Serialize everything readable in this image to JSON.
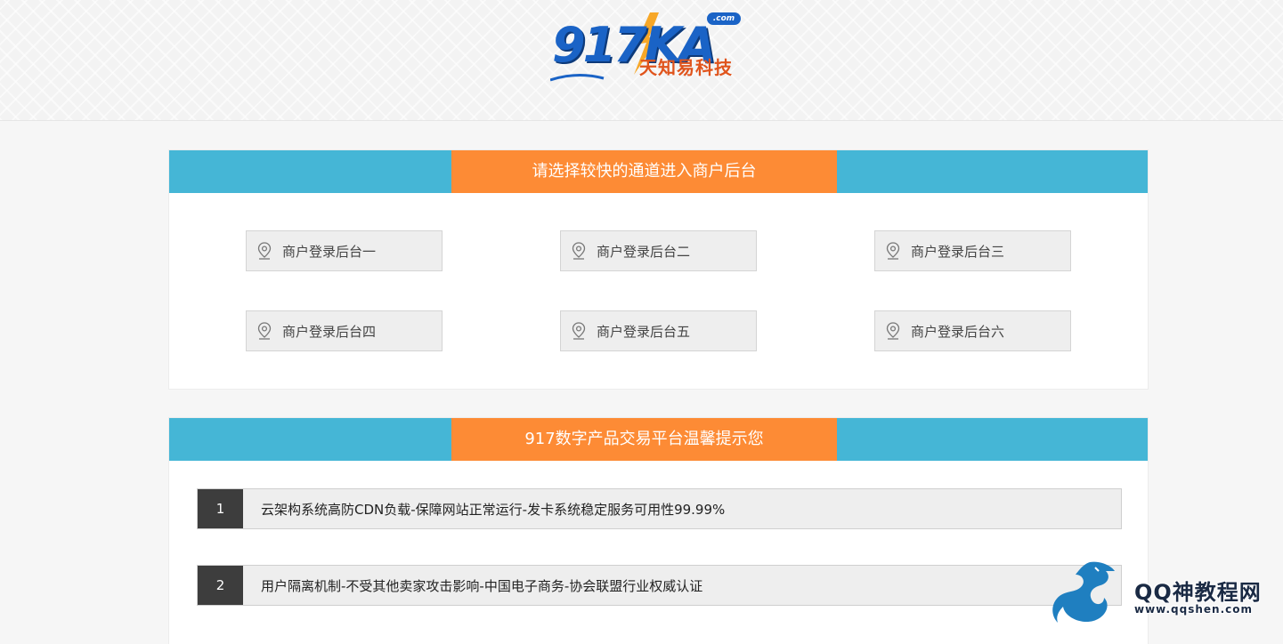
{
  "header": {
    "logo": {
      "main": "917KA",
      "dotcom": ".com",
      "subtitle": "天知易科技"
    }
  },
  "login_panel": {
    "title": "请选择较快的通道进入商户后台",
    "buttons": [
      {
        "label": "商户登录后台一",
        "icon": "location-pin-icon"
      },
      {
        "label": "商户登录后台二",
        "icon": "location-pin-icon"
      },
      {
        "label": "商户登录后台三",
        "icon": "location-pin-icon"
      },
      {
        "label": "商户登录后台四",
        "icon": "location-pin-icon"
      },
      {
        "label": "商户登录后台五",
        "icon": "location-pin-icon"
      },
      {
        "label": "商户登录后台六",
        "icon": "location-pin-icon"
      }
    ]
  },
  "tips_panel": {
    "title": "917数字产品交易平台温馨提示您",
    "items": [
      {
        "num": "1",
        "text": "云架构系统高防CDN负载-保障网站正常运行-发卡系统稳定服务可用性99.99%"
      },
      {
        "num": "2",
        "text": "用户隔离机制-不受其他卖家攻击影响-中国电子商务-协会联盟行业权威认证"
      }
    ]
  },
  "watermark": {
    "title": "QQ神教程网",
    "url": "www.qqshen.com"
  },
  "colors": {
    "header_bar": "#45b6d6",
    "title_tab": "#fd8b35",
    "tip_number_bg": "#3d3d3d",
    "button_bg": "#eeeeee"
  }
}
